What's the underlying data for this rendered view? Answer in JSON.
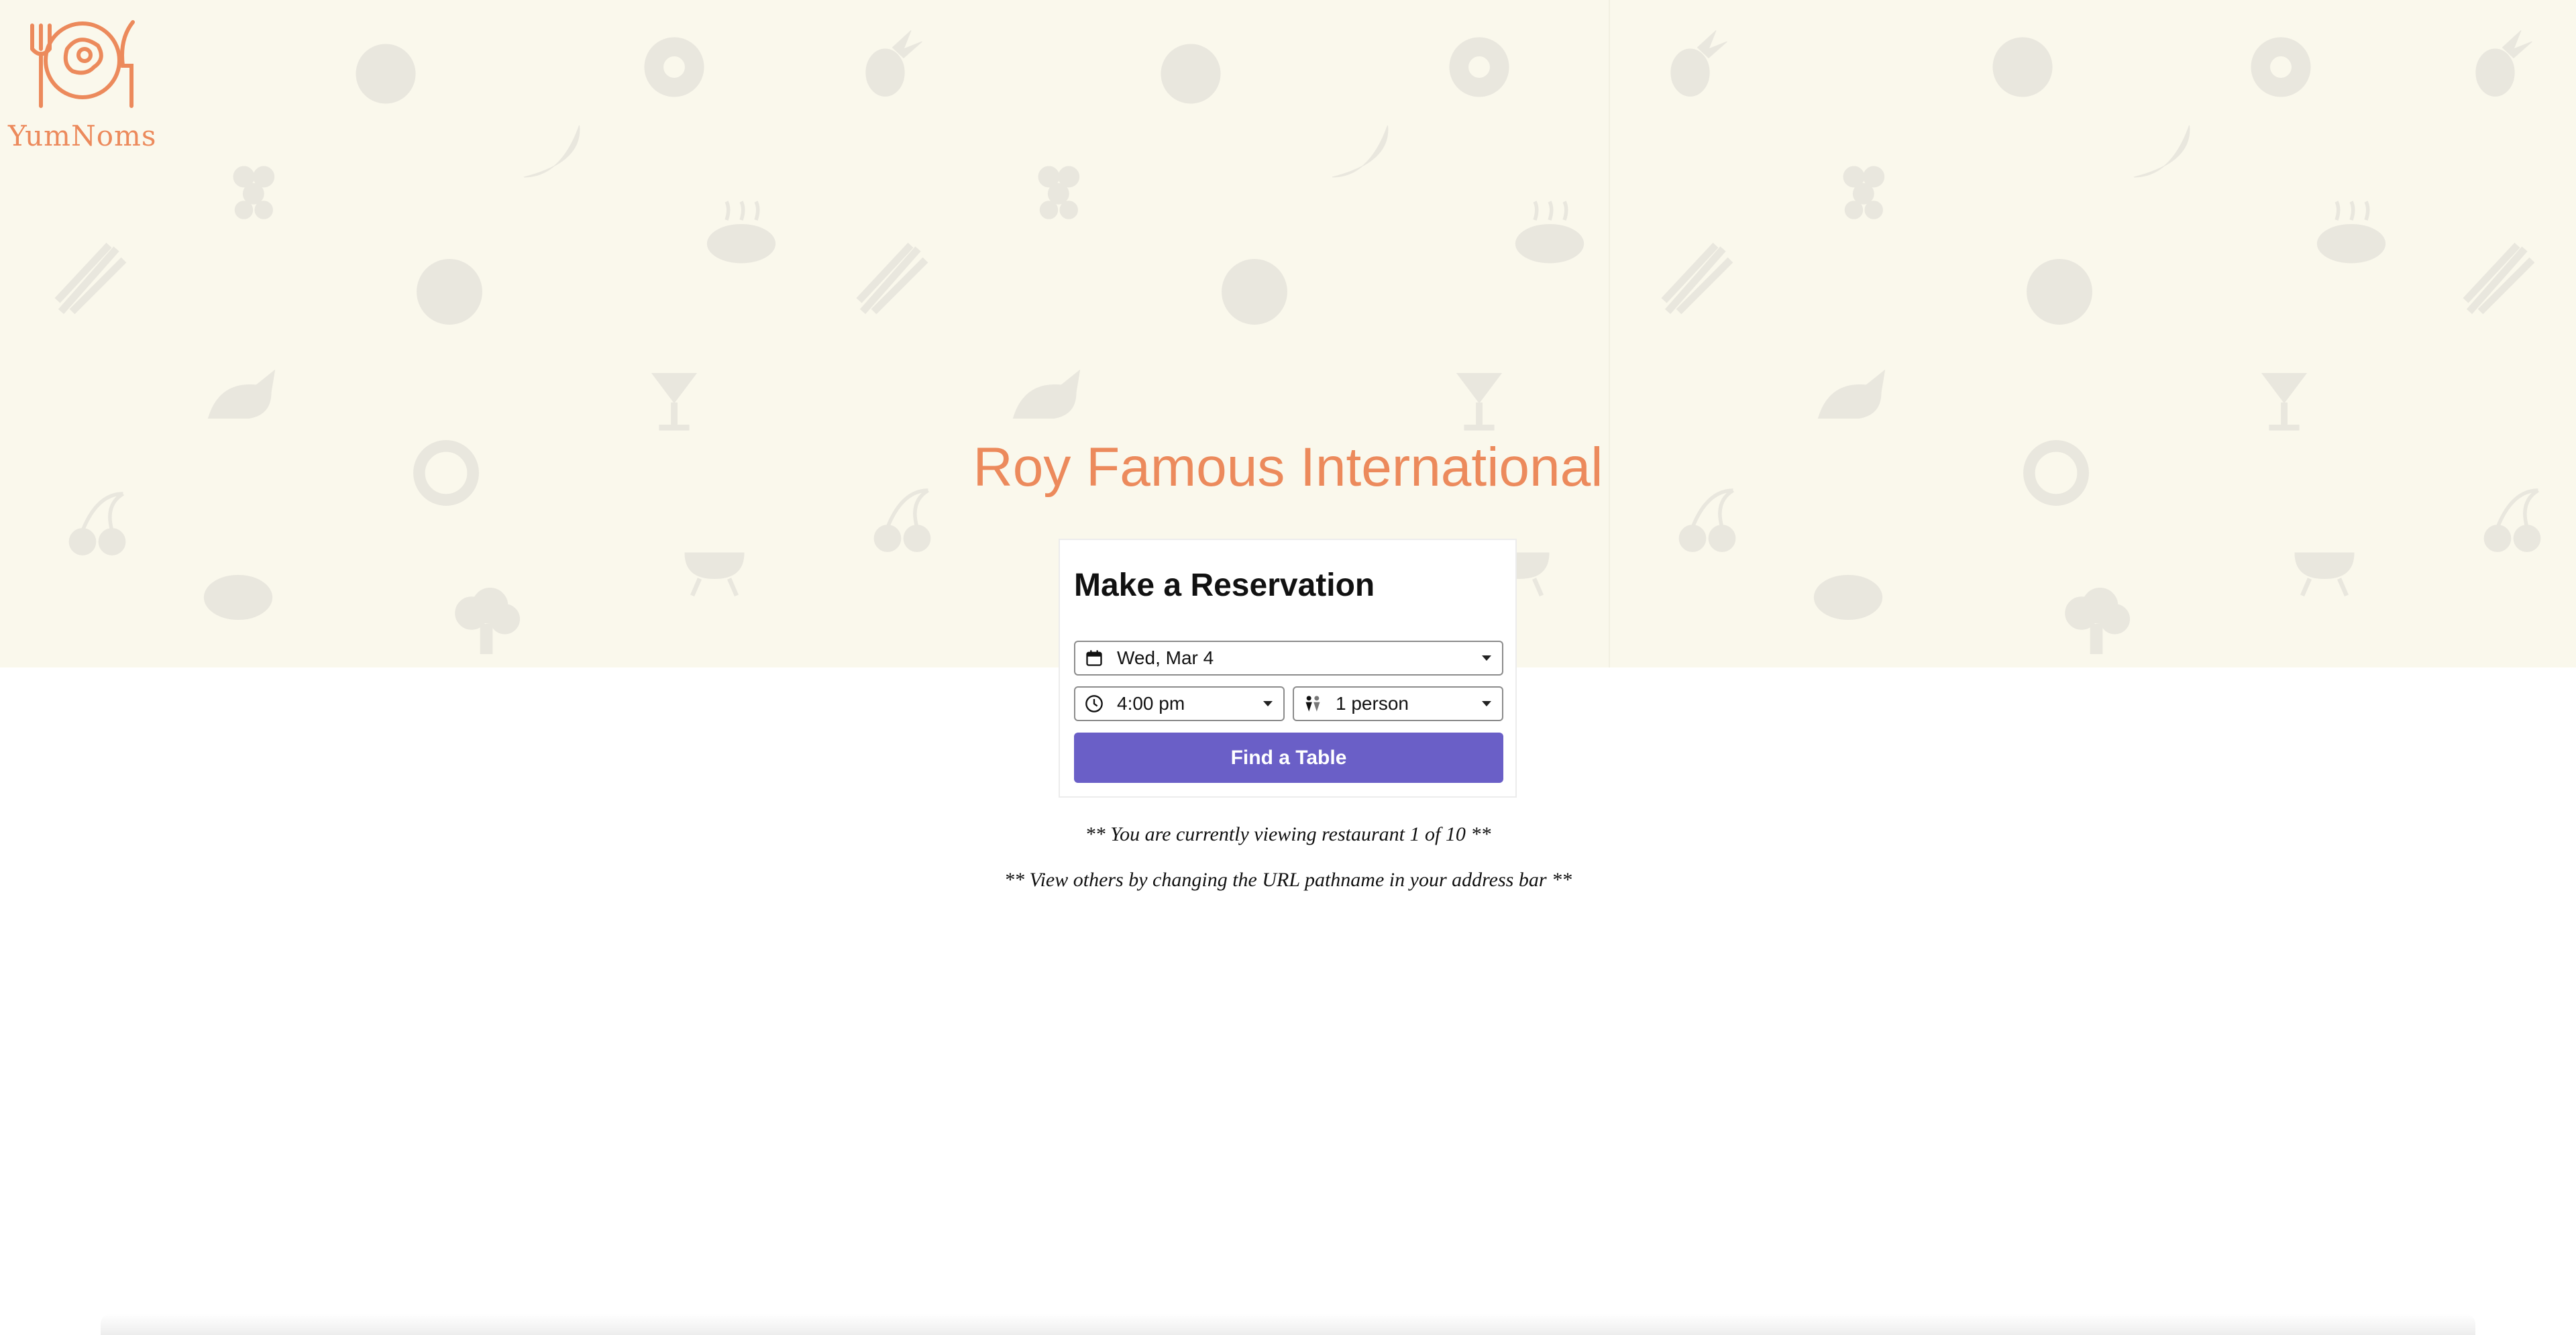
{
  "brand": {
    "name": "YumNoms",
    "logo_icon": "plate-fork-knife-icon",
    "accent_color": "#ec8a5c"
  },
  "restaurant": {
    "name": "Roy Famous International"
  },
  "reservation": {
    "heading": "Make a Reservation",
    "date": {
      "value": "Wed, Mar 4",
      "icon": "calendar-icon"
    },
    "time": {
      "value": "4:00 pm",
      "icon": "clock-icon"
    },
    "party_size": {
      "value": "1 person",
      "icon": "people-icon"
    },
    "submit_label": "Find a Table",
    "button_color": "#6a5fc7"
  },
  "notes": {
    "current": "** You are currently viewing restaurant 1 of 10 **",
    "hint": "** View others by changing the URL pathname in your address bar **"
  },
  "hero": {
    "background_color": "#faf8ec",
    "pattern_icons": [
      "watermelon-icon",
      "donut-icon",
      "pineapple-icon",
      "banana-icon",
      "grapes-icon",
      "steak-icon",
      "asparagus-icon",
      "citrus-icon",
      "roast-chicken-icon",
      "cocktail-icon",
      "cherry-icon",
      "bread-icon",
      "grill-icon",
      "broccoli-icon",
      "plate-icon"
    ]
  }
}
